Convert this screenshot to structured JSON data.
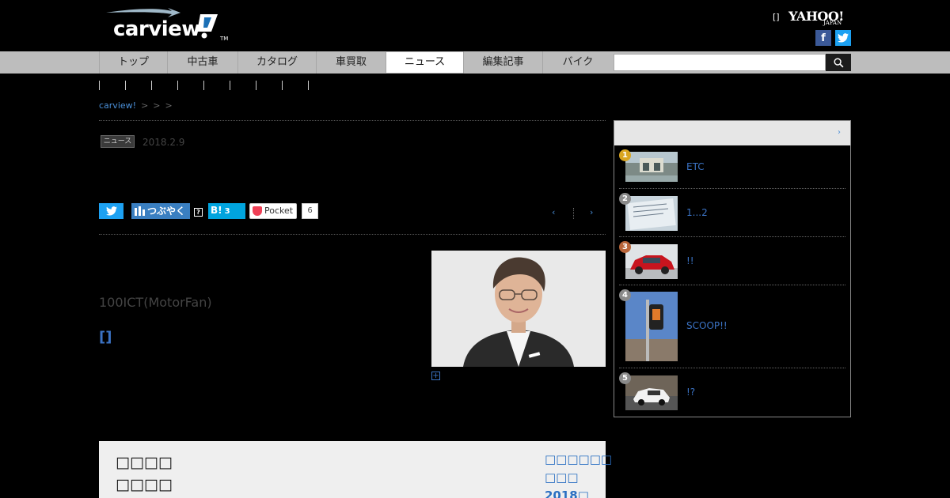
{
  "header": {
    "logo_text": "carview",
    "logo_tm": "TM",
    "yahoo_bracket": "[]",
    "yahoo_logo": "YAHOO!",
    "yahoo_sub": "JAPAN",
    "facebook_glyph": "f"
  },
  "nav": {
    "items": [
      {
        "label": "トップ"
      },
      {
        "label": "中古車"
      },
      {
        "label": "カタログ"
      },
      {
        "label": "車買取"
      },
      {
        "label": "ニュース"
      },
      {
        "label": "編集記事"
      },
      {
        "label": "バイク"
      }
    ],
    "active_index": 4,
    "search_placeholder": ""
  },
  "breadcrumb": {
    "root": "carview!",
    "gt": ">"
  },
  "article": {
    "category_badge": "ニュース記事",
    "date": "2018.2.9",
    "lead": "100ICT(MotorFan)",
    "link_label": "[]"
  },
  "share": {
    "mixi_label": "つぶやく",
    "mixi_help": "?",
    "hatena_label": "B!",
    "hatena_count": "3",
    "pocket_label": "Pocket",
    "pocket_count": "6"
  },
  "pager": {
    "prev": "‹",
    "next": "›"
  },
  "bottom_box": {
    "left_line1": "□□□□",
    "left_line2": "□□□□",
    "right_line1": "□□□□□□",
    "right_line2": "□□□",
    "right_line3": "2018□"
  },
  "ranking": {
    "more_arrow": "›",
    "items": [
      {
        "rank": "1",
        "title": "ETC",
        "rank_color": "#d9a520"
      },
      {
        "rank": "2",
        "title": "1...2",
        "rank_color": "#8a8a8a"
      },
      {
        "rank": "3",
        "title": "!!",
        "rank_color": "#b8653a"
      },
      {
        "rank": "4",
        "title": "SCOOP!!",
        "rank_color": "#8a8a8a"
      },
      {
        "rank": "5",
        "title": "!?",
        "rank_color": "#8a8a8a"
      }
    ]
  }
}
